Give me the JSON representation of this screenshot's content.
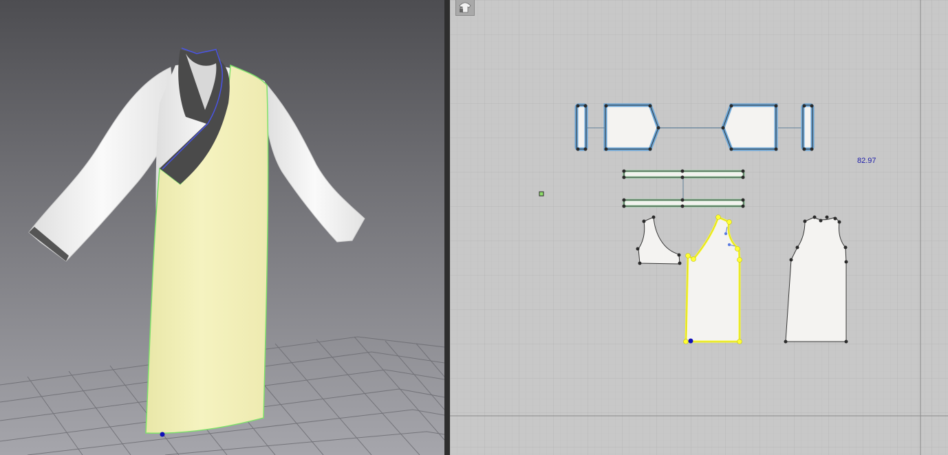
{
  "viewport_3d": {
    "background_top": "#4e4e52",
    "background_bottom": "#a4a4aa",
    "avatar_floor_grid": "on"
  },
  "garment_colors": {
    "shirt": "#f4f4f4",
    "collar": "#4a4a4a",
    "selected_panel": "#f0eeb4",
    "selection_outline": "#7de06a",
    "collar_outline": "#4a55e6"
  },
  "pattern_window": {
    "background": "#c8c8c8",
    "selection_color": "#ffff33",
    "seam_color": "#6aa6d8",
    "tool_icon": "lock-shirt-icon",
    "length_readout": "82.97"
  }
}
